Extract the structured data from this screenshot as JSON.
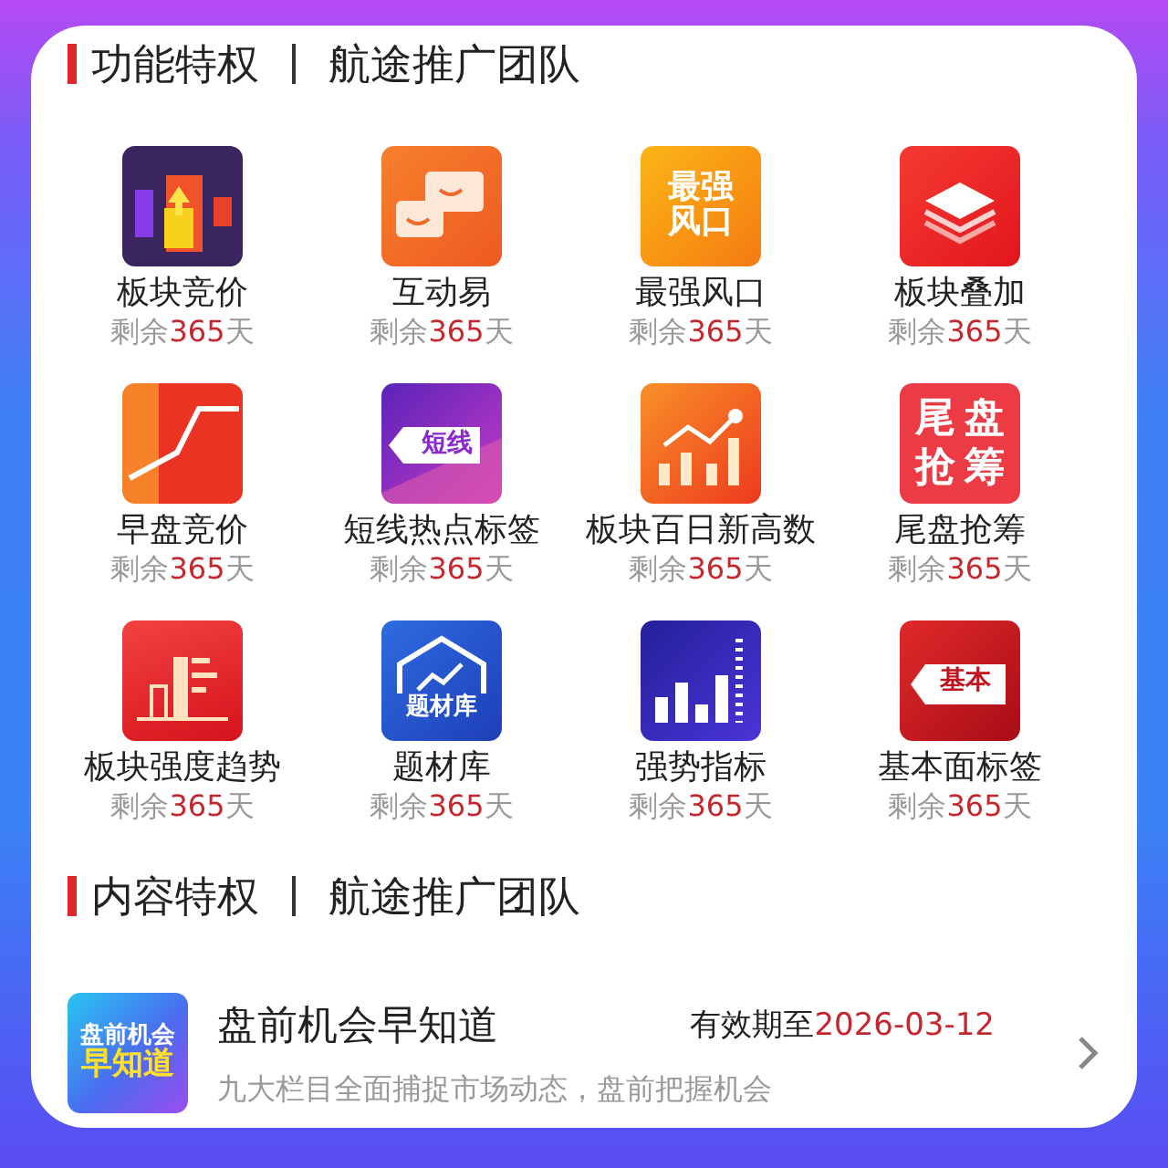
{
  "sections": [
    {
      "title": "功能特权",
      "team": "航途推广团队",
      "features": [
        {
          "name": "板块竞价",
          "remain_prefix": "剩余",
          "days": "365",
          "remain_suffix": "天",
          "icon": {
            "kind": "cubes"
          }
        },
        {
          "name": "互动易",
          "remain_prefix": "剩余",
          "days": "365",
          "remain_suffix": "天",
          "icon": {
            "kind": "chat"
          }
        },
        {
          "name": "最强风口",
          "remain_prefix": "剩余",
          "days": "365",
          "remain_suffix": "天",
          "icon": {
            "kind": "words",
            "lines": [
              "最强",
              "风口"
            ]
          }
        },
        {
          "name": "板块叠加",
          "remain_prefix": "剩余",
          "days": "365",
          "remain_suffix": "天",
          "icon": {
            "kind": "puzzle"
          }
        },
        {
          "name": "早盘竞价",
          "remain_prefix": "剩余",
          "days": "365",
          "remain_suffix": "天",
          "icon": {
            "kind": "jump"
          }
        },
        {
          "name": "短线热点标签",
          "remain_prefix": "剩余",
          "days": "365",
          "remain_suffix": "天",
          "icon": {
            "kind": "tag-purple",
            "lines": [
              "短线"
            ]
          }
        },
        {
          "name": "板块百日新高数",
          "remain_prefix": "剩余",
          "days": "365",
          "remain_suffix": "天",
          "icon": {
            "kind": "bar-line"
          }
        },
        {
          "name": "尾盘抢筹",
          "remain_prefix": "剩余",
          "days": "365",
          "remain_suffix": "天",
          "icon": {
            "kind": "grid-words",
            "lines": [
              "尾",
              "盘",
              "抢",
              "筹"
            ]
          }
        },
        {
          "name": "板块强度趋势",
          "remain_prefix": "剩余",
          "days": "365",
          "remain_suffix": "天",
          "icon": {
            "kind": "bars-flag"
          }
        },
        {
          "name": "题材库",
          "remain_prefix": "剩余",
          "days": "365",
          "remain_suffix": "天",
          "icon": {
            "kind": "house",
            "lines": [
              "题材库"
            ]
          }
        },
        {
          "name": "强势指标",
          "remain_prefix": "剩余",
          "days": "365",
          "remain_suffix": "天",
          "icon": {
            "kind": "bars-tower"
          }
        },
        {
          "name": "基本面标签",
          "remain_prefix": "剩余",
          "days": "365",
          "remain_suffix": "天",
          "icon": {
            "kind": "tag-red",
            "lines": [
              "基本"
            ]
          }
        }
      ]
    },
    {
      "title": "内容特权",
      "team": "航途推广团队",
      "contents": [
        {
          "title": "盘前机会早知道",
          "validity_label": "有效期至",
          "validity_date": "2026-03-12",
          "description": "九大栏目全面捕捉市场动态，盘前把握机会",
          "icon": {
            "kind": "promo",
            "lines": [
              "盘前机会",
              "早知道"
            ]
          }
        }
      ]
    }
  ]
}
